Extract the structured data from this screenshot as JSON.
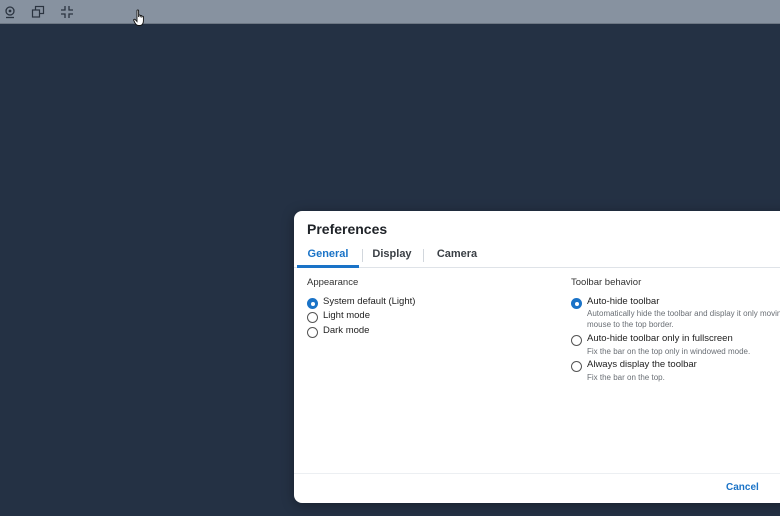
{
  "topbar": {
    "icons": [
      "webcam-icon",
      "windows-icon",
      "fullscreen-exit-icon"
    ]
  },
  "dialog": {
    "title": "Preferences",
    "tabs": [
      {
        "label": "General",
        "active": true
      },
      {
        "label": "Display",
        "active": false
      },
      {
        "label": "Camera",
        "active": false
      }
    ],
    "appearance": {
      "label": "Appearance",
      "options": [
        {
          "label": "System default (Light)",
          "checked": true
        },
        {
          "label": "Light mode",
          "checked": false
        },
        {
          "label": "Dark mode",
          "checked": false
        }
      ]
    },
    "toolbar": {
      "label": "Toolbar behavior",
      "options": [
        {
          "label": "Auto-hide toolbar",
          "desc": "Automatically hide the toolbar and display it only moving mouse to the top border.",
          "checked": true
        },
        {
          "label": "Auto-hide toolbar only in fullscreen",
          "desc": "Fix the bar on the top only in windowed mode.",
          "checked": false
        },
        {
          "label": "Always display the toolbar",
          "desc": "Fix the bar on the top.",
          "checked": false
        }
      ]
    },
    "footer": {
      "cancel_label": "Cancel"
    }
  },
  "colors": {
    "background": "#243144",
    "accent": "#1a73c7",
    "topbar": "#8792a0"
  }
}
